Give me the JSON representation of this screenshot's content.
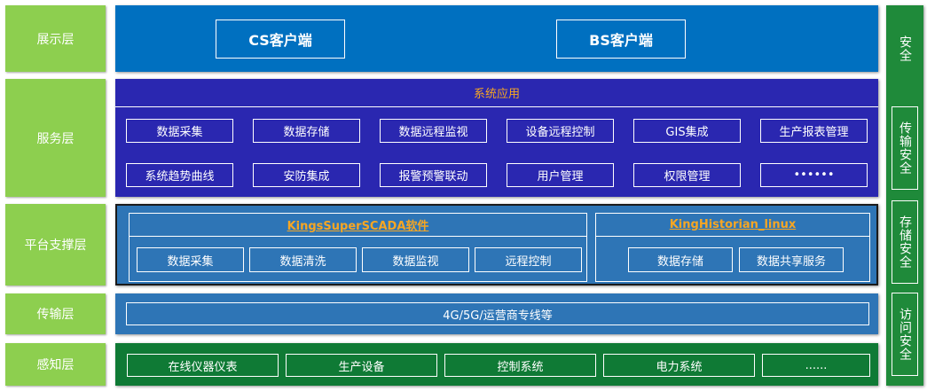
{
  "layers": {
    "display": "展示层",
    "service": "服务层",
    "platform": "平台支撑层",
    "transport": "传输层",
    "perception": "感知层"
  },
  "display": {
    "cs_client": "CS客户端",
    "bs_client": "BS客户端"
  },
  "service": {
    "title": "系统应用",
    "row1": [
      "数据采集",
      "数据存储",
      "数据远程监视",
      "设备远程控制",
      "GIS集成",
      "生产报表管理"
    ],
    "row2": [
      "系统趋势曲线",
      "安防集成",
      "报警预警联动",
      "用户管理",
      "权限管理",
      "••••••"
    ]
  },
  "platform": {
    "scada_title": "KingsSuperSCADA软件",
    "scada_items": [
      "数据采集",
      "数据清洗",
      "数据监视",
      "远程控制"
    ],
    "historian_title": "KingHistorian_linux",
    "historian_items": [
      "数据存储",
      "数据共享服务"
    ]
  },
  "transport": {
    "content": "4G/5G/运营商专线等"
  },
  "perception": {
    "items": [
      "在线仪器仪表",
      "生产设备",
      "控制系统",
      "电力系统",
      "......"
    ]
  },
  "security": {
    "top": "安全",
    "transmission": "传输安全",
    "storage": "存储安全",
    "access": "访问安全"
  },
  "colors": {
    "label_green": "#8dcf4f",
    "display_blue": "#0070c0",
    "service_indigo": "#2a27b0",
    "platform_blue": "#2e75b6",
    "perception_green": "#0f7a35",
    "security_green": "#1f8a3a",
    "accent_orange": "#f6a623"
  }
}
